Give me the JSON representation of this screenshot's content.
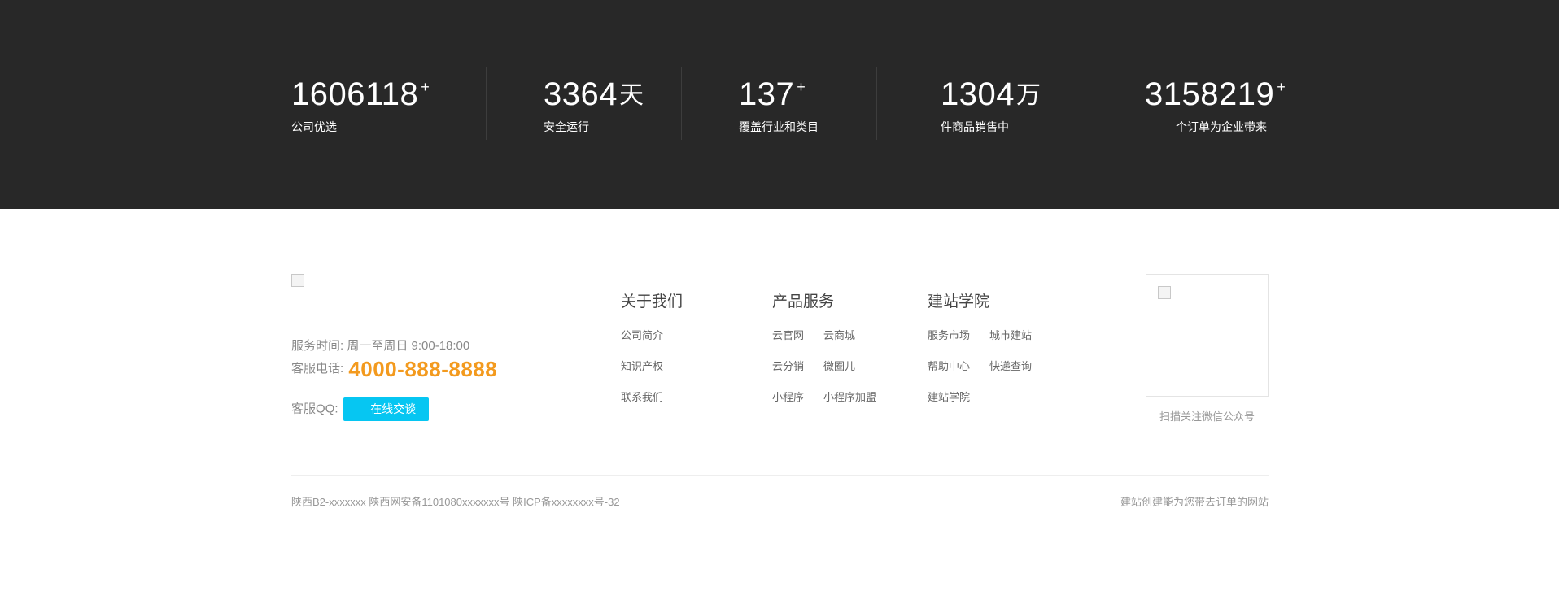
{
  "stats": [
    {
      "number": "1606118",
      "sup": "+",
      "unit": "",
      "label": "公司优选"
    },
    {
      "number": "3364",
      "sup": "",
      "unit": "天",
      "label": "安全运行"
    },
    {
      "number": "137",
      "sup": "+",
      "unit": "",
      "label": "覆盖行业和类目"
    },
    {
      "number": "1304",
      "sup": "",
      "unit": "万",
      "label": "件商品销售中"
    },
    {
      "number": "3158219",
      "sup": "+",
      "unit": "",
      "label": "个订单为企业带来"
    }
  ],
  "contact": {
    "hours_label": "服务时间:",
    "hours_value": "周一至周日 9:00-18:00",
    "phone_label": "客服电话:",
    "phone_value": "4000-888-8888",
    "qq_label": "客服QQ:",
    "chat_button": "在线交谈"
  },
  "columns": [
    {
      "title": "关于我们",
      "links": [
        "公司简介",
        "知识产权",
        "联系我们"
      ]
    },
    {
      "title": "产品服务",
      "links": [
        "云官网",
        "云商城",
        "云分销",
        "微圈儿",
        "小程序",
        "小程序加盟"
      ]
    },
    {
      "title": "建站学院",
      "links": [
        "服务市场",
        "城市建站",
        "帮助中心",
        "快递查询",
        "建站学院"
      ]
    }
  ],
  "qr": {
    "caption": "扫描关注微信公众号"
  },
  "bottom": {
    "copyright": "陕西B2-xxxxxxx 陕西网安备1101080xxxxxxx号 陕ICP备xxxxxxxx号-32",
    "slogan": "建站创建能为您带去订单的网站"
  },
  "colors": {
    "dark_band": "#282828",
    "accent_orange": "#f39a1e",
    "chat_blue": "#06c6f2"
  }
}
